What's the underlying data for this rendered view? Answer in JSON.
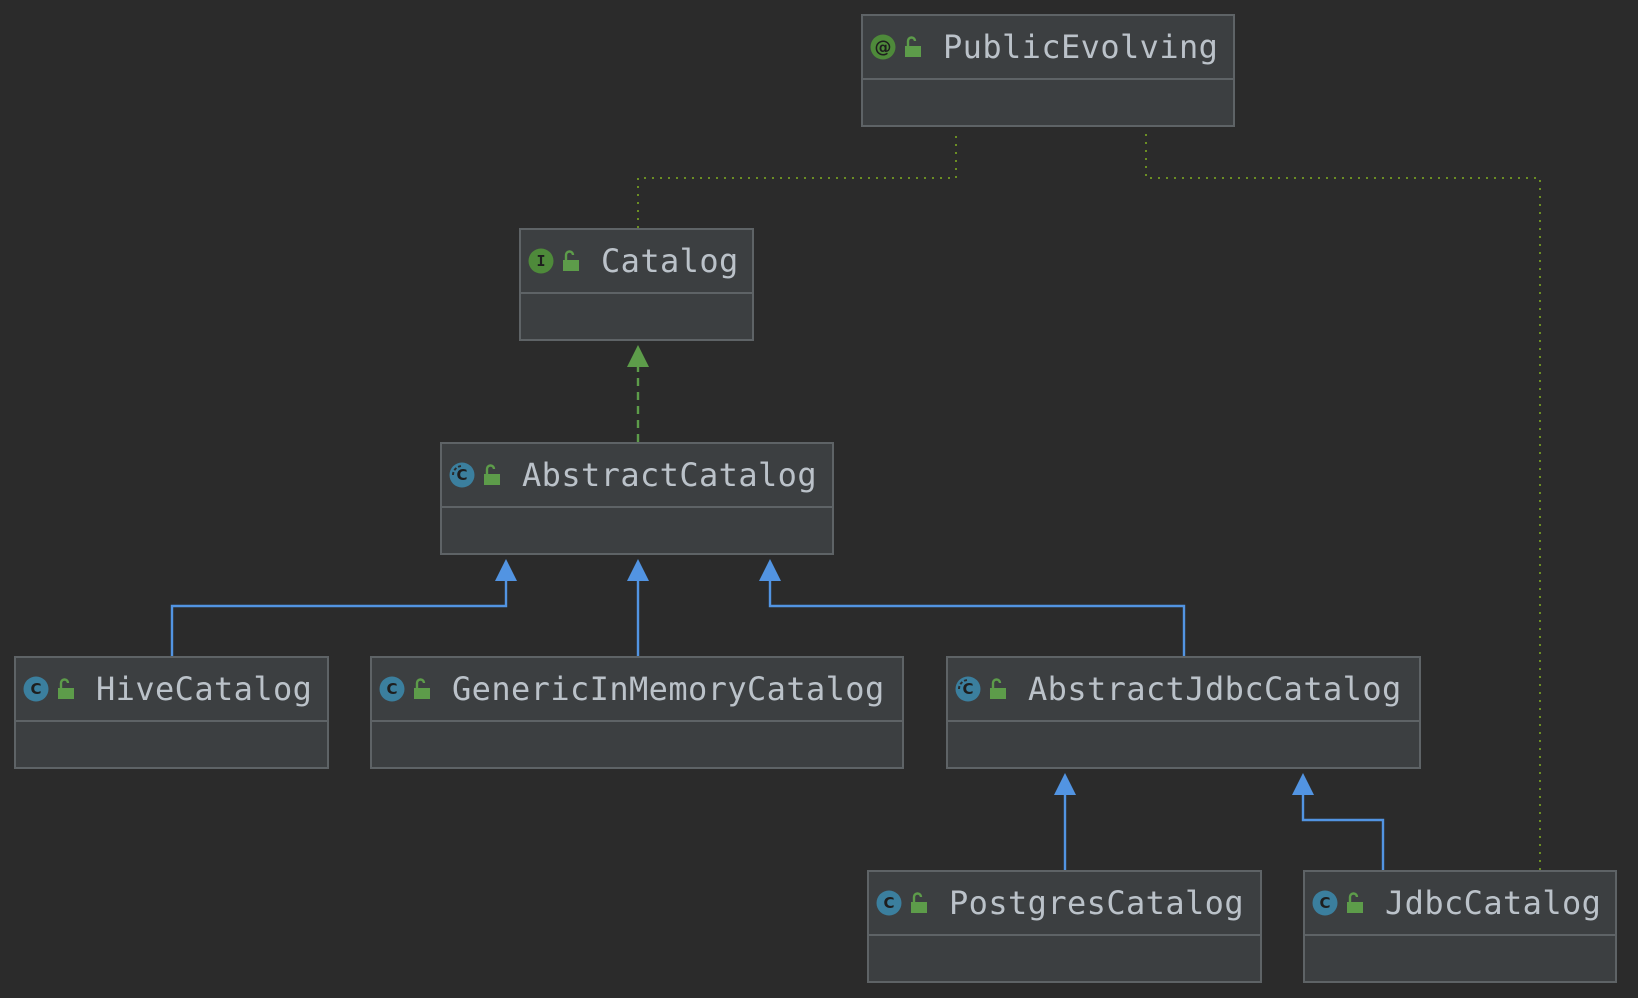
{
  "nodes": [
    {
      "id": "PublicEvolving",
      "name": "PublicEvolving",
      "kind": "annotation"
    },
    {
      "id": "Catalog",
      "name": "Catalog",
      "kind": "interface"
    },
    {
      "id": "AbstractCatalog",
      "name": "AbstractCatalog",
      "kind": "abstract-class"
    },
    {
      "id": "HiveCatalog",
      "name": "HiveCatalog",
      "kind": "class"
    },
    {
      "id": "GenericInMemoryCatalog",
      "name": "GenericInMemoryCatalog",
      "kind": "class"
    },
    {
      "id": "AbstractJdbcCatalog",
      "name": "AbstractJdbcCatalog",
      "kind": "abstract-class"
    },
    {
      "id": "PostgresCatalog",
      "name": "PostgresCatalog",
      "kind": "class"
    },
    {
      "id": "JdbcCatalog",
      "name": "JdbcCatalog",
      "kind": "class"
    }
  ],
  "edges": [
    {
      "from": "Catalog",
      "to": "PublicEvolving",
      "relation": "annotated-by",
      "style": "dotted"
    },
    {
      "from": "JdbcCatalog",
      "to": "PublicEvolving",
      "relation": "annotated-by",
      "style": "dotted"
    },
    {
      "from": "AbstractCatalog",
      "to": "Catalog",
      "relation": "implements",
      "style": "dashed"
    },
    {
      "from": "HiveCatalog",
      "to": "AbstractCatalog",
      "relation": "extends",
      "style": "solid"
    },
    {
      "from": "GenericInMemoryCatalog",
      "to": "AbstractCatalog",
      "relation": "extends",
      "style": "solid"
    },
    {
      "from": "AbstractJdbcCatalog",
      "to": "AbstractCatalog",
      "relation": "extends",
      "style": "solid"
    },
    {
      "from": "PostgresCatalog",
      "to": "AbstractJdbcCatalog",
      "relation": "extends",
      "style": "solid"
    },
    {
      "from": "JdbcCatalog",
      "to": "AbstractJdbcCatalog",
      "relation": "extends",
      "style": "solid"
    }
  ],
  "icon_letters": {
    "annotation": "@",
    "interface": "I",
    "class": "C"
  },
  "colors": {
    "background": "#2b2b2b",
    "node_fill": "#3c3f41",
    "node_border": "#5e6366",
    "text": "#bbc2c9",
    "extends_edge": "#5294e2",
    "implements_edge": "#5d9c4a",
    "annotation_edge": "#6b8e23",
    "class_icon": "#3b7f9e",
    "interface_icon": "#4e8a3a",
    "lock_icon": "#5d9c4a"
  }
}
